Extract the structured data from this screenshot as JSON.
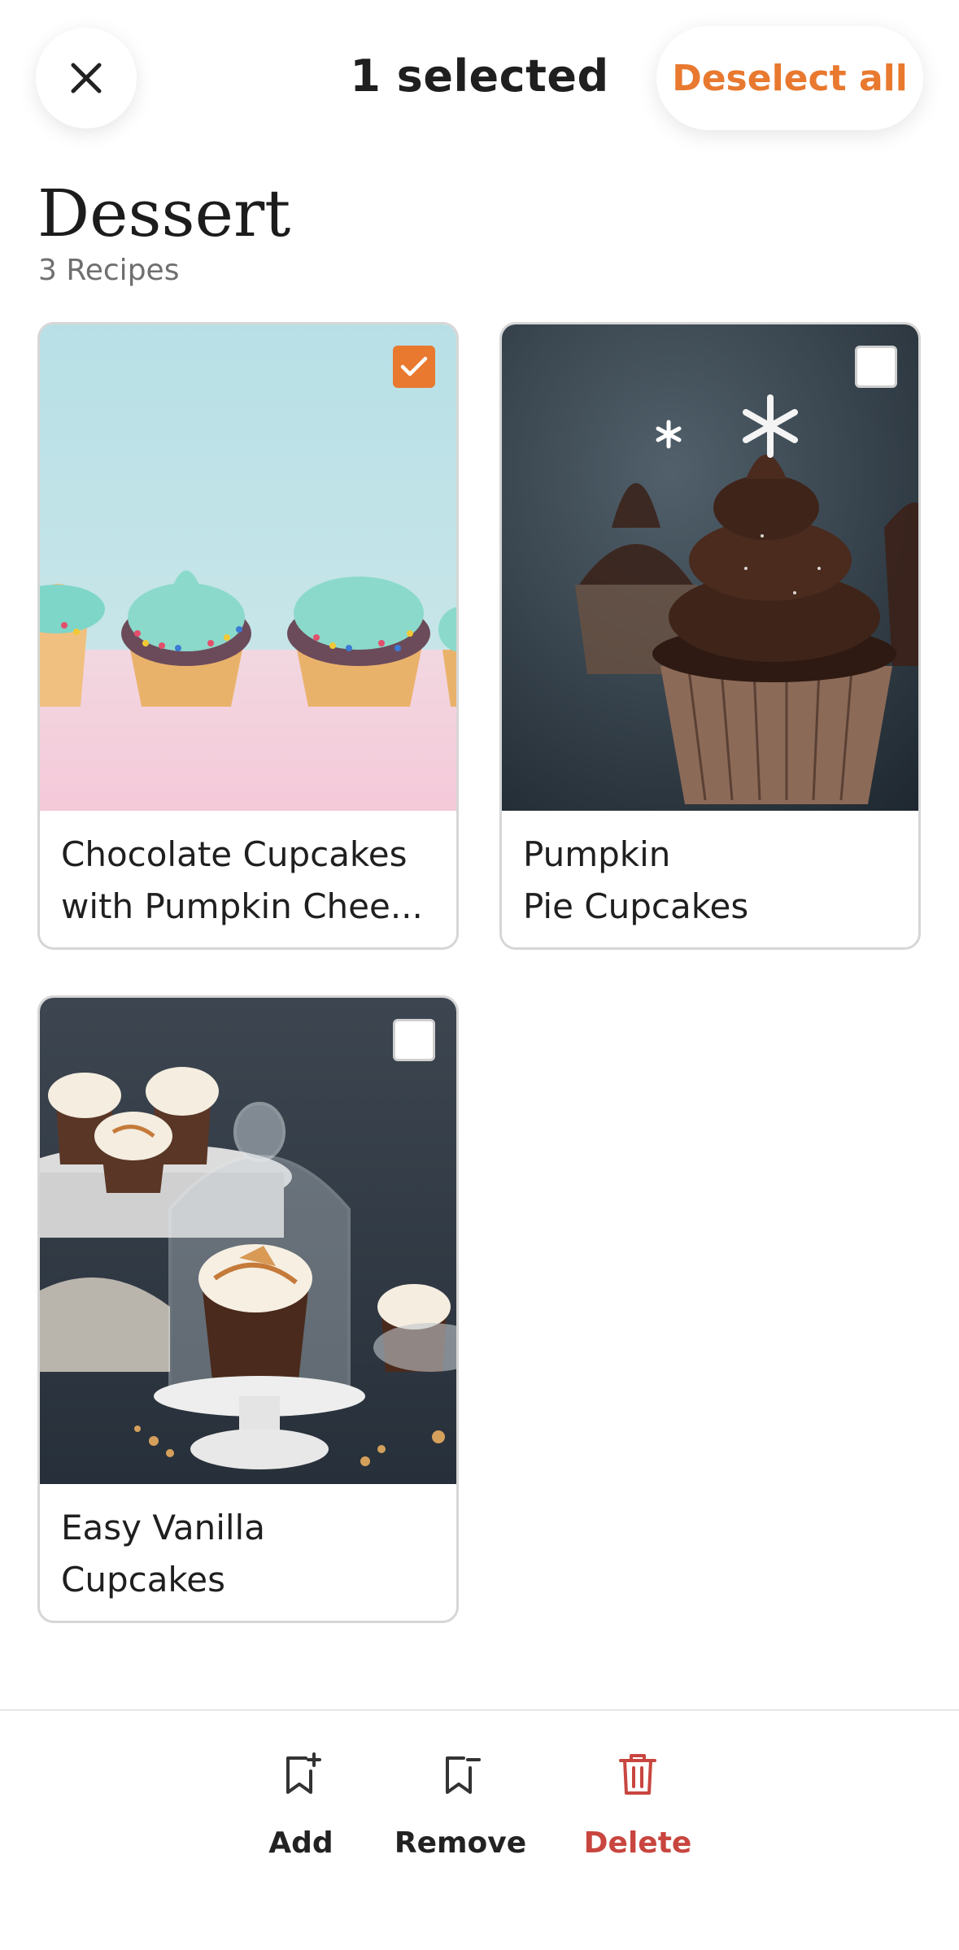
{
  "header": {
    "selected_label": "1 selected",
    "deselect_all_label": "Deselect all",
    "close_icon": "close-icon"
  },
  "collection": {
    "title": "Dessert",
    "count_label": "3 Recipes"
  },
  "recipes": [
    {
      "title_line1": "Chocolate Cupcakes",
      "title_line2": "with Pumpkin Chee...",
      "selected": true,
      "image": "teal-frosted-sprinkle-cupcakes"
    },
    {
      "title_line1": "Pumpkin",
      "title_line2": "Pie Cupcakes",
      "selected": false,
      "image": "chocolate-swirl-cupcakes-snowflake"
    },
    {
      "title_line1": "Easy Vanilla",
      "title_line2": "Cupcakes",
      "selected": false,
      "image": "cupcake-under-glass-dome"
    }
  ],
  "actions": [
    {
      "label": "Add",
      "icon": "bookmark-add-icon"
    },
    {
      "label": "Remove",
      "icon": "bookmark-remove-icon"
    },
    {
      "label": "Delete",
      "icon": "trash-icon"
    }
  ],
  "colors": {
    "accent": "#e8792f",
    "danger": "#c8463f",
    "text": "#1f1f1f",
    "muted": "#6f6f6f"
  }
}
